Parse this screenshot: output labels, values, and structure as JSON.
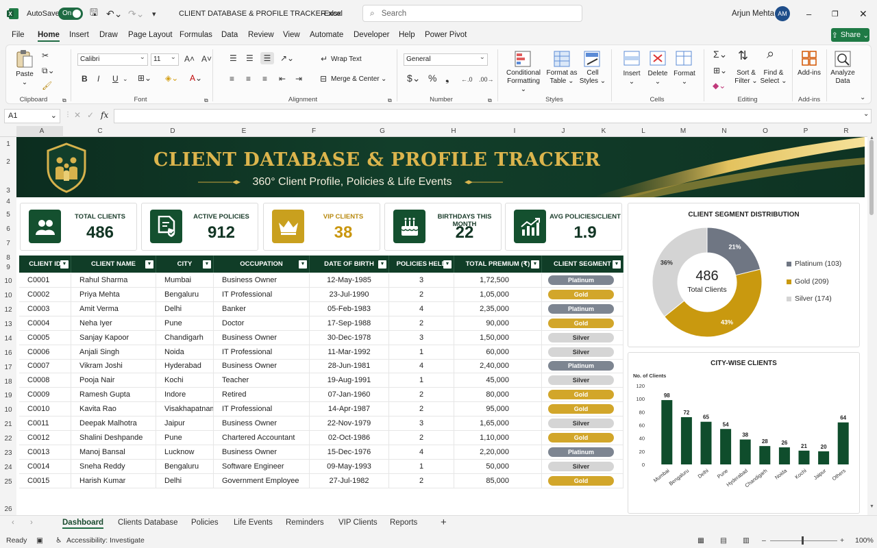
{
  "titlebar": {
    "autosave_label": "AutoSave",
    "autosave_state": "On",
    "file_name": "CLIENT DATABASE & PROFILE TRACKER.xlsx",
    "app_name": "Excel",
    "search_placeholder": "Search",
    "user_name": "Arjun Mehta",
    "user_initials": "AM"
  },
  "menu": [
    "File",
    "Home",
    "Insert",
    "Draw",
    "Page Layout",
    "Formulas",
    "Data",
    "Review",
    "View",
    "Automate",
    "Developer",
    "Help",
    "Power Pivot"
  ],
  "share_label": "Share",
  "ribbon": {
    "paste": "Paste",
    "font_name": "Calibri",
    "font_size": "11",
    "wrap_text": "Wrap Text",
    "merge_center": "Merge & Center",
    "number_format": "General",
    "conditional_formatting": [
      "Conditional",
      "Formatting"
    ],
    "format_as_table": [
      "Format as",
      "Table"
    ],
    "cell_styles": [
      "Cell",
      "Styles"
    ],
    "insert": "Insert",
    "delete": "Delete",
    "format": "Format",
    "sort_filter": [
      "Sort &",
      "Filter"
    ],
    "find_select": [
      "Find &",
      "Select"
    ],
    "add_ins": "Add-ins",
    "analyze_data": [
      "Analyze",
      "Data"
    ],
    "groups": [
      "Clipboard",
      "Font",
      "Alignment",
      "Number",
      "Styles",
      "Cells",
      "Editing",
      "Add-ins"
    ]
  },
  "formula_bar": {
    "name_box": "A1",
    "fx": "fx",
    "content": ""
  },
  "columns": [
    "A",
    "C",
    "D",
    "E",
    "F",
    "G",
    "H",
    "I",
    "J",
    "K",
    "L",
    "M",
    "N",
    "O",
    "P",
    "R"
  ],
  "rows": [
    "1",
    "2",
    "3",
    "4",
    "5",
    "6",
    "7",
    "8",
    "9",
    "10",
    "10",
    "12",
    "13",
    "14",
    "16",
    "17",
    "18",
    "19",
    "10",
    "21",
    "22",
    "23",
    "24",
    "25",
    "26"
  ],
  "banner": {
    "title": "CLIENT DATABASE & PROFILE TRACKER",
    "subtitle": "360° Client Profile, Policies & Life Events"
  },
  "kpis": [
    {
      "label": "TOTAL CLIENTS",
      "value": "486",
      "icon": "users-icon"
    },
    {
      "label": "ACTIVE POLICIES",
      "value": "912",
      "icon": "policy-document-icon"
    },
    {
      "label": "VIP CLIENTS",
      "value": "38",
      "icon": "crown-icon"
    },
    {
      "label": "BIRTHDAYS THIS MONTH",
      "value": "22",
      "icon": "cake-icon"
    },
    {
      "label": "AVG POLICIES/CLIENT",
      "value": "1.9",
      "icon": "growth-chart-icon"
    }
  ],
  "table": {
    "headers": [
      "CLIENT ID",
      "CLIENT NAME",
      "CITY",
      "OCCUPATION",
      "DATE OF BIRTH",
      "POLICIES HELD",
      "TOTAL PREMIUM (₹)",
      "CLIENT SEGMENT"
    ],
    "rows": [
      [
        "C0001",
        "Rahul Sharma",
        "Mumbai",
        "Business Owner",
        "12-May-1985",
        "3",
        "1,72,500",
        "Platinum"
      ],
      [
        "C0002",
        "Priya Mehta",
        "Bengaluru",
        "IT Professional",
        "23-Jul-1990",
        "2",
        "1,05,000",
        "Gold"
      ],
      [
        "C0003",
        "Amit Verma",
        "Delhi",
        "Banker",
        "05-Feb-1983",
        "4",
        "2,35,000",
        "Platinum"
      ],
      [
        "C0004",
        "Neha Iyer",
        "Pune",
        "Doctor",
        "17-Sep-1988",
        "2",
        "90,000",
        "Gold"
      ],
      [
        "C0005",
        "Sanjay Kapoor",
        "Chandigarh",
        "Business Owner",
        "30-Dec-1978",
        "3",
        "1,50,000",
        "Silver"
      ],
      [
        "C0006",
        "Anjali Singh",
        "Noida",
        "IT Professional",
        "11-Mar-1992",
        "1",
        "60,000",
        "Silver"
      ],
      [
        "C0007",
        "Vikram Joshi",
        "Hyderabad",
        "Business Owner",
        "28-Jun-1981",
        "4",
        "2,40,000",
        "Platinum"
      ],
      [
        "C0008",
        "Pooja Nair",
        "Kochi",
        "Teacher",
        "19-Aug-1991",
        "1",
        "45,000",
        "Silver"
      ],
      [
        "C0009",
        "Ramesh Gupta",
        "Indore",
        "Retired",
        "07-Jan-1960",
        "2",
        "80,000",
        "Gold"
      ],
      [
        "C0010",
        "Kavita Rao",
        "Visakhapatnam",
        "IT Professional",
        "14-Apr-1987",
        "2",
        "95,000",
        "Gold"
      ],
      [
        "C0011",
        "Deepak Malhotra",
        "Jaipur",
        "Business Owner",
        "22-Nov-1979",
        "3",
        "1,65,000",
        "Silver"
      ],
      [
        "C0012",
        "Shalini Deshpande",
        "Pune",
        "Chartered Accountant",
        "02-Oct-1986",
        "2",
        "1,10,000",
        "Gold"
      ],
      [
        "C0013",
        "Manoj Bansal",
        "Lucknow",
        "Business Owner",
        "15-Dec-1976",
        "4",
        "2,20,000",
        "Platinum"
      ],
      [
        "C0014",
        "Sneha Reddy",
        "Bengaluru",
        "Software Engineer",
        "09-May-1993",
        "1",
        "50,000",
        "Silver"
      ],
      [
        "C0015",
        "Harish Kumar",
        "Delhi",
        "Government Employee",
        "27-Jul-1982",
        "2",
        "85,000",
        "Gold"
      ]
    ]
  },
  "segment_colors": {
    "Platinum": "#7d8591",
    "Gold": "#d2a62a",
    "Silver": "#d5d5d5"
  },
  "chart_data": [
    {
      "type": "pie",
      "title": "CLIENT SEGMENT DISTRIBUTION",
      "center_value": "486",
      "center_label": "Total Clients",
      "slices": [
        {
          "name": "Platinum",
          "value": 103,
          "label": "21%",
          "legend": "Platinum (103)",
          "color": "#6f7683"
        },
        {
          "name": "Gold",
          "value": 209,
          "label": "43%",
          "legend": "Gold (209)",
          "color": "#c9990f"
        },
        {
          "name": "Silver",
          "value": 174,
          "label": "36%",
          "legend": "Silver (174)",
          "color": "#d4d4d4"
        }
      ]
    },
    {
      "type": "bar",
      "title": "CITY-WISE CLIENTS",
      "ylabel": "No. of Clients",
      "ylim": [
        0,
        120
      ],
      "yticks": [
        0,
        20,
        40,
        60,
        80,
        100,
        120
      ],
      "categories": [
        "Mumbai",
        "Bengaluru",
        "Delhi",
        "Pune",
        "Hyderabad",
        "Chandigarh",
        "Noida",
        "Kochi",
        "Jaipur",
        "Others"
      ],
      "values": [
        98,
        72,
        65,
        54,
        38,
        28,
        26,
        21,
        20,
        64
      ],
      "color": "#0f4d2c"
    }
  ],
  "sheet_tabs": [
    "Dashboard",
    "Clients Database",
    "Policies",
    "Life Events",
    "Reminders",
    "VIP Clients",
    "Reports"
  ],
  "status": {
    "ready": "Ready",
    "accessibility": "Accessibility: Investigate",
    "zoom": "100%"
  }
}
